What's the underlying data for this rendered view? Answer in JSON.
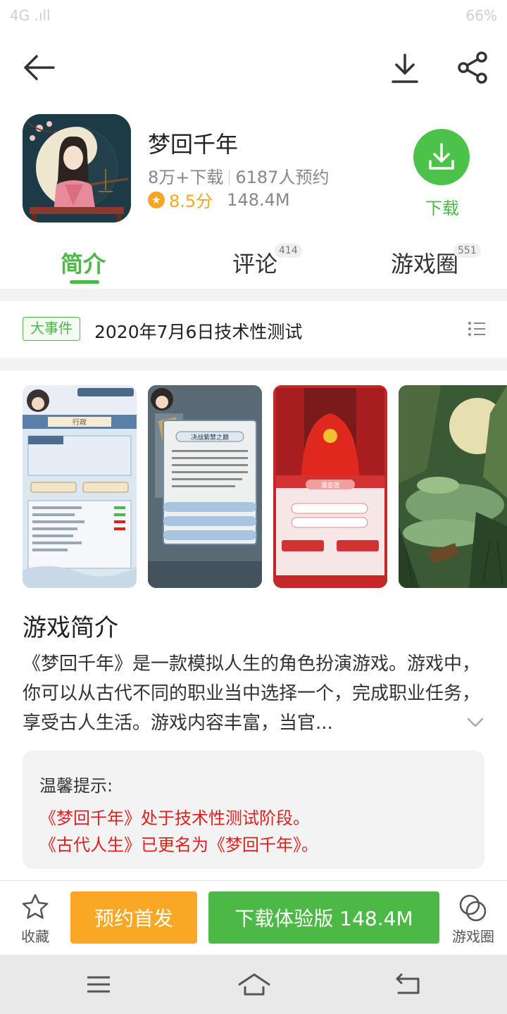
{
  "status_bar": {
    "left": "4G .ıll",
    "right": "66%"
  },
  "header": {
    "back_icon": "arrow-left-icon",
    "download_icon": "download-icon",
    "share_icon": "share-icon"
  },
  "app": {
    "name": "梦回千年",
    "downloads": "8万+下载",
    "reservations": "6187人预约",
    "score": "8.5分",
    "size": "148.4M",
    "download_label": "下载"
  },
  "tabs": [
    {
      "label": "简介",
      "badge": ""
    },
    {
      "label": "评论",
      "badge": "414"
    },
    {
      "label": "游戏圈",
      "badge": "551"
    }
  ],
  "event": {
    "tag": "大事件",
    "text": "2020年7月6日技术性测试"
  },
  "screenshots": [
    {
      "caption": "行政"
    },
    {
      "caption": "决战紫禁之巅"
    },
    {
      "caption": "潘金莲"
    },
    {
      "caption": ""
    }
  ],
  "description": {
    "title": "游戏简介",
    "body": "《梦回千年》是一款模拟人生的角色扮演游戏。游戏中，你可以从古代不同的职业当中选择一个，完成职业任务，享受古人生活。游戏内容丰富，当官..."
  },
  "tip": {
    "title": "温馨提示:",
    "line1": "《梦回千年》处于技术性测试阶段。",
    "line2": "《古代人生》已更名为《梦回千年》。"
  },
  "bottom": {
    "favorite": "收藏",
    "reserve": "预约首发",
    "download_trial": "下载体验版 148.4M",
    "circle": "游戏圈"
  },
  "colors": {
    "accent": "#4db848",
    "orange": "#f9a825",
    "red": "#e02020",
    "star": "#f6a623"
  }
}
